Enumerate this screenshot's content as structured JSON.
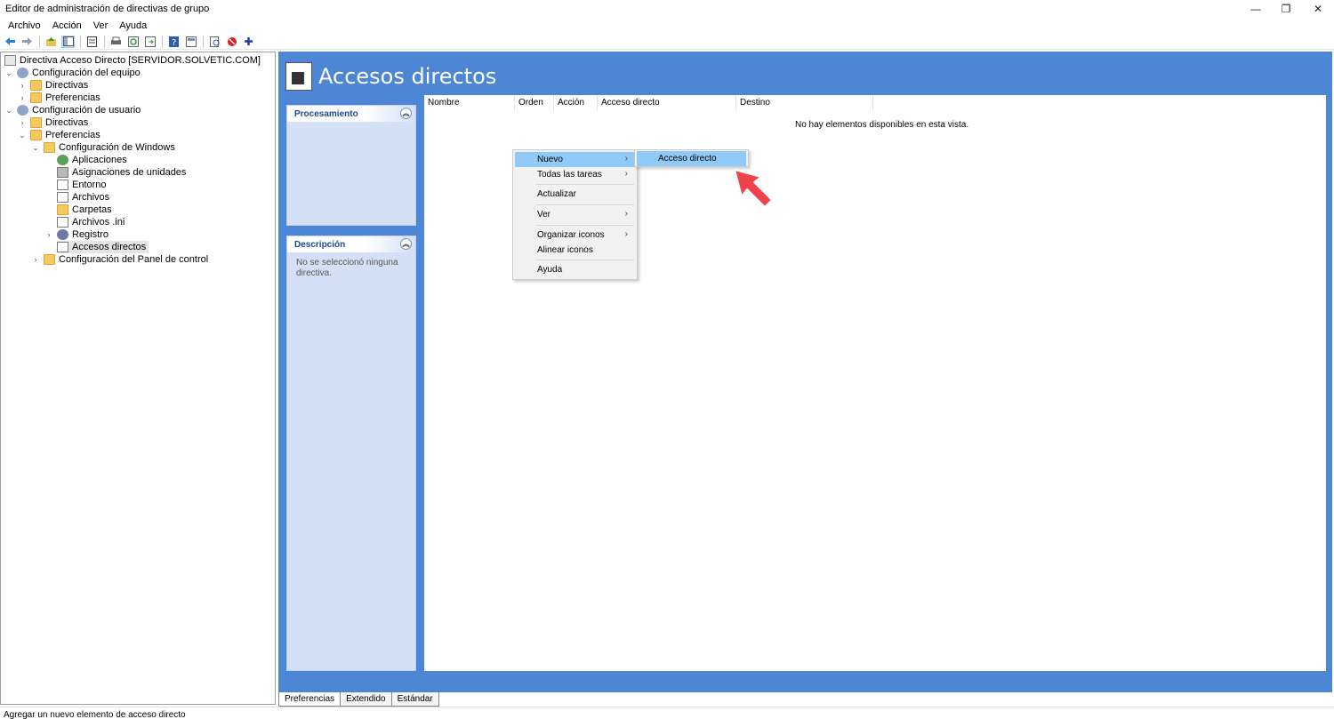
{
  "window": {
    "title": "Editor de administración de directivas de grupo",
    "min_glyph": "—",
    "max_glyph": "❐",
    "close_glyph": "✕"
  },
  "menu": [
    "Archivo",
    "Acción",
    "Ver",
    "Ayuda"
  ],
  "toolbar_icons": [
    "back-icon",
    "forward-icon",
    "up-icon",
    "show-hide-tree-icon",
    "properties-icon",
    "print-icon",
    "refresh-icon",
    "export-icon",
    "help-icon",
    "details-icon",
    "preview-icon",
    "stop-icon",
    "add-icon"
  ],
  "tree": {
    "root": "Directiva Acceso Directo [SERVIDOR.SOLVETIC.COM]",
    "computer_config": "Configuración del equipo",
    "computer_policies": "Directivas",
    "computer_prefs": "Preferencias",
    "user_config": "Configuración de usuario",
    "user_policies": "Directivas",
    "user_prefs": "Preferencias",
    "windows_settings": "Configuración de Windows",
    "applications": "Aplicaciones",
    "drive_maps": "Asignaciones de unidades",
    "environment": "Entorno",
    "files": "Archivos",
    "folders": "Carpetas",
    "ini_files": "Archivos .ini",
    "registry": "Registro",
    "shortcuts": "Accesos directos",
    "control_panel": "Configuración del Panel de control"
  },
  "main": {
    "title": "Accesos directos",
    "processing_panel": "Procesamiento",
    "description_panel": "Descripción",
    "description_text": "No se seleccionó ninguna directiva.",
    "columns": [
      "Nombre",
      "Orden",
      "Acción",
      "Acceso directo",
      "Destino"
    ],
    "empty_message": "No hay elementos disponibles en esta vista."
  },
  "context_menu": {
    "new": "Nuevo",
    "all_tasks": "Todas las tareas",
    "refresh": "Actualizar",
    "view": "Ver",
    "arrange_icons": "Organizar iconos",
    "align_icons": "Alinear iconos",
    "help": "Ayuda",
    "submenu_item": "Acceso directo",
    "arrow": "›"
  },
  "tabs": [
    "Preferencias",
    "Extendido",
    "Estándar"
  ],
  "status": "Agregar un nuevo elemento de acceso directo",
  "colors": {
    "header_blue": "#4e86d6",
    "panel_blue": "#d4e0f6",
    "menu_highlight": "#91c9f7",
    "pointer_red": "#f0424a"
  }
}
